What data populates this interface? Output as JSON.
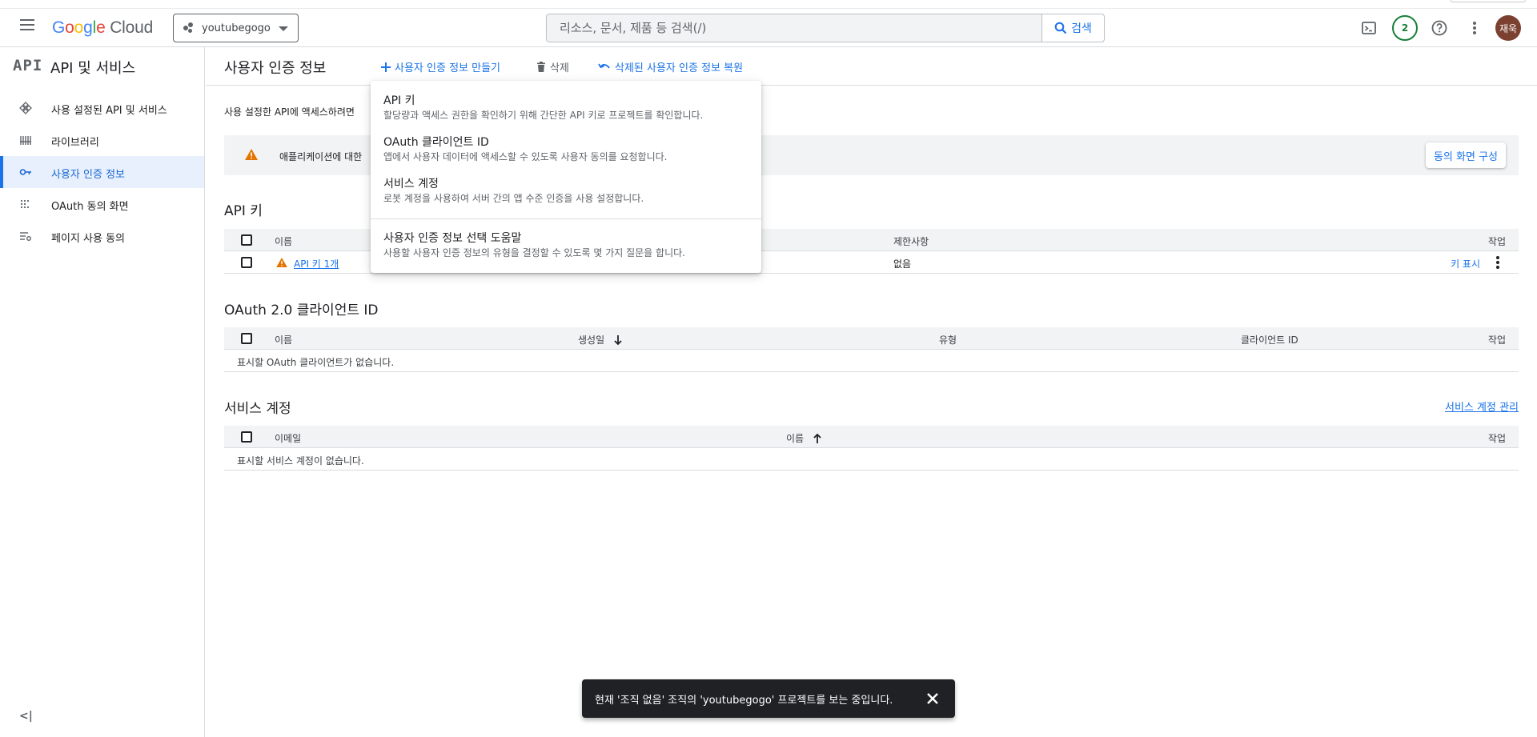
{
  "header": {
    "logo_google": [
      "G",
      "o",
      "o",
      "g",
      "l",
      "e"
    ],
    "logo_cloud": "Cloud",
    "project_name": "youtubegogo",
    "search_placeholder": "리소스, 문서, 제품 등 검색(/)",
    "search_button": "검색",
    "notification_count": "2",
    "avatar_text": "재욱"
  },
  "sidebar": {
    "logo": "API",
    "title": "API 및 서비스",
    "items": [
      {
        "label": "사용 설정된 API 및 서비스",
        "icon": "api-hub-icon",
        "active": false
      },
      {
        "label": "라이브러리",
        "icon": "library-icon",
        "active": false
      },
      {
        "label": "사용자 인증 정보",
        "icon": "key-icon",
        "active": true
      },
      {
        "label": "OAuth 동의 화면",
        "icon": "consent-dots-icon",
        "active": false
      },
      {
        "label": "페이지 사용 동의",
        "icon": "settings-list-icon",
        "active": false
      }
    ],
    "collapse_icon": "<|"
  },
  "pagebar": {
    "title": "사용자 인증 정보",
    "create_label": "사용자 인증 정보 만들기",
    "delete_label": "삭제",
    "restore_label": "삭제된 사용자 인증 정보 복원"
  },
  "intro_text": "사용 설정한 API에 액세스하려면",
  "warning": {
    "text": "애플리케이션에 대한",
    "button": "동의 화면 구성"
  },
  "api_keys": {
    "title": "API 키",
    "columns": {
      "name": "이름",
      "restrictions": "제한사항",
      "actions": "작업"
    },
    "rows": [
      {
        "name": "API 키 1개",
        "restrictions": "없음",
        "action": "키 표시"
      }
    ]
  },
  "oauth": {
    "title": "OAuth 2.0 클라이언트 ID",
    "columns": {
      "name": "이름",
      "created": "생성일",
      "type": "유형",
      "client_id": "클라이언트 ID",
      "actions": "작업"
    },
    "empty": "표시할 OAuth 클라이언트가 없습니다."
  },
  "service_accounts": {
    "title": "서비스 계정",
    "manage_link": "서비스 계정 관리",
    "columns": {
      "email": "이메일",
      "name": "이름",
      "actions": "작업"
    },
    "empty": "표시할 서비스 계정이 없습니다."
  },
  "dropdown": {
    "items": [
      {
        "title": "API 키",
        "desc": "할당량과 액세스 권한을 확인하기 위해 간단한 API 키로 프로젝트를 확인합니다."
      },
      {
        "title": "OAuth 클라이언트 ID",
        "desc": "앱에서 사용자 데이터에 액세스할 수 있도록 사용자 동의를 요청합니다."
      },
      {
        "title": "서비스 계정",
        "desc": "로봇 계정을 사용하여 서버 간의 앱 수준 인증을 사용 설정합니다."
      },
      {
        "title": "사용자 인증 정보 선택 도움말",
        "desc": "사용할 사용자 인증 정보의 유형을 결정할 수 있도록 몇 가지 질문을 합니다."
      }
    ]
  },
  "snackbar": {
    "message": "현재 '조직 없음' 조직의 'youtubegogo' 프로젝트를 보는 중입니다."
  },
  "colors": {
    "accent": "#1a73e8",
    "active_bg": "#e8f0fe",
    "warning": "#e37400",
    "notification": "#188038",
    "avatar_bg": "#7b4030"
  }
}
